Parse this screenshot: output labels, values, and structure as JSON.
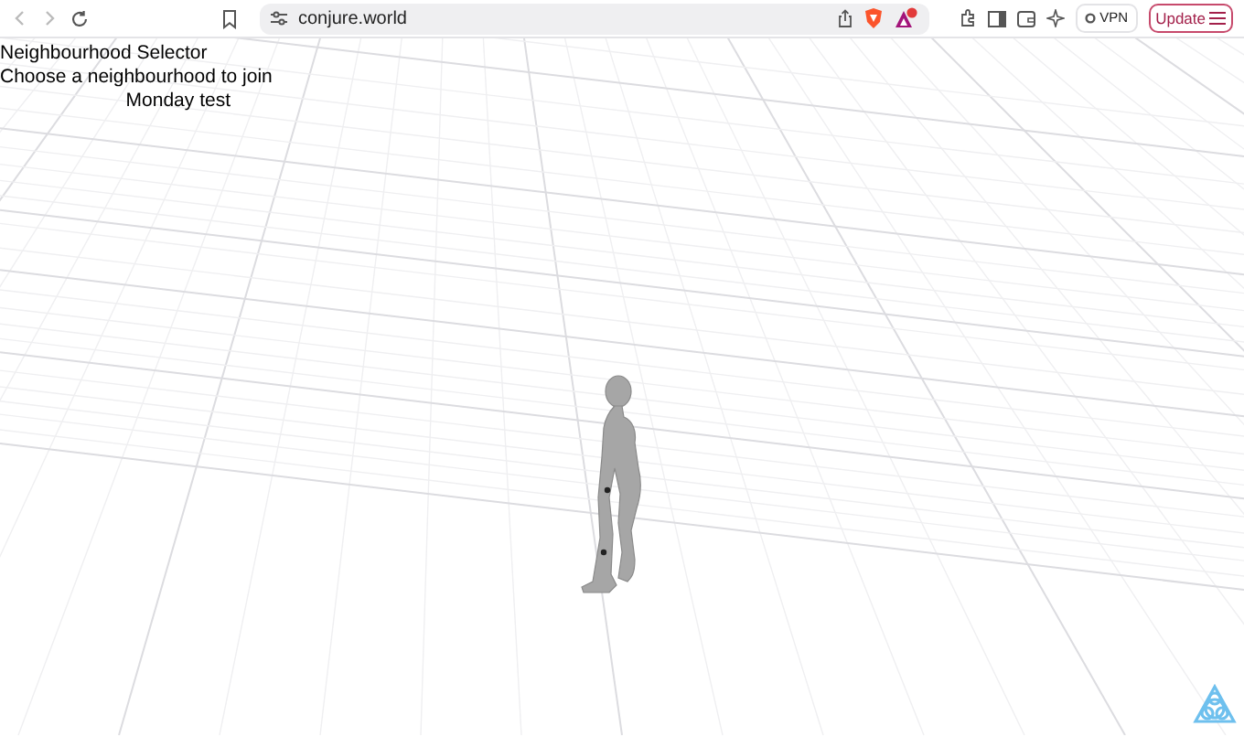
{
  "browser": {
    "url": "conjure.world",
    "vpn_label": "VPN",
    "update_label": "Update"
  },
  "page": {
    "title": "Neighbourhood Selector",
    "subtitle": "Choose a neighbourhood to join",
    "neighbourhoods": [
      {
        "name": "Monday test"
      }
    ]
  }
}
